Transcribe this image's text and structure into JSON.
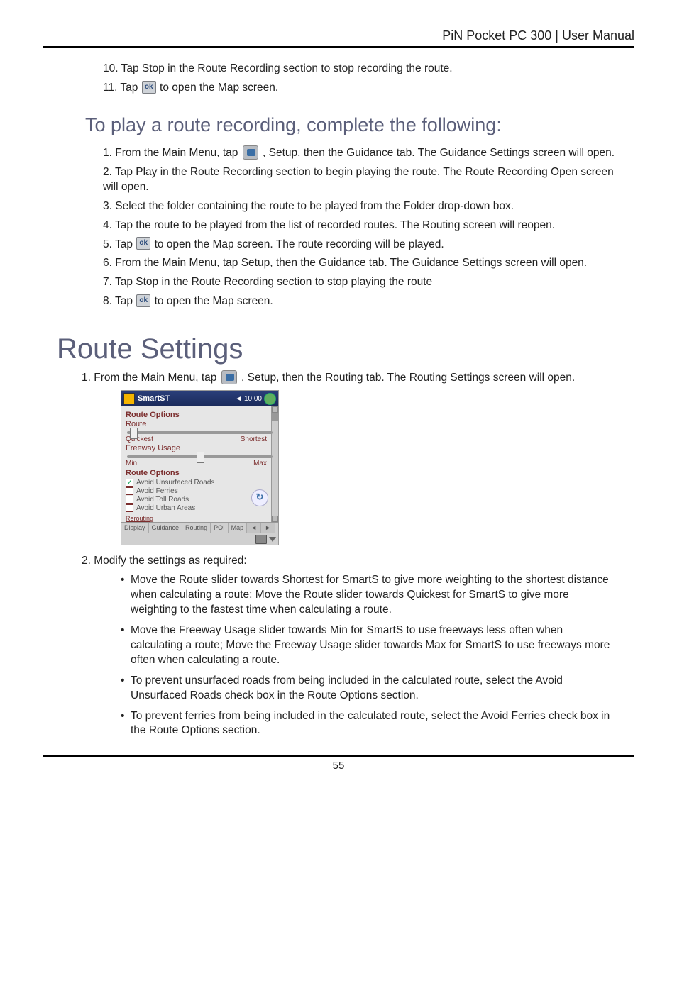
{
  "header": {
    "title": "PiN Pocket PC 300 | User Manual"
  },
  "topsteps": [
    "10. Tap Stop in the Route Recording section to stop recording the route.",
    "11. Tap |OK| to open the Map screen."
  ],
  "section_play": {
    "heading": "To play a route recording, complete the following:",
    "steps": [
      "1. From the Main Menu, tap |SETUP| , Setup, then the Guidance tab. The Guidance Settings screen will open.",
      "2. Tap Play in the Route Recording section to begin playing the route. The Route Recording Open screen will open.",
      "3. Select the folder containing the route to be played from the Folder drop-down box.",
      "4. Tap the route to be played from the list of recorded routes. The Routing screen will reopen.",
      "5. Tap |OK| to open the Map screen. The route recording will be played.",
      "6. From the Main Menu, tap Setup, then the Guidance tab. The Guidance Settings screen will open.",
      "7. Tap Stop in the Route Recording section to stop playing the route",
      "8. Tap |OK| to open the Map screen."
    ]
  },
  "section_route": {
    "heading": "Route Settings",
    "intro": "1. From the Main Menu, tap |SETUP| , Setup, then the Routing tab. The Routing Settings screen will open.",
    "device": {
      "title": "SmartST",
      "clock": "◄ 10:00",
      "h1": "Route Options",
      "sub1": "Route",
      "slider1": {
        "left": "Quickest",
        "right": "Shortest",
        "pos": 2
      },
      "sub2": "Freeway Usage",
      "slider2": {
        "left": "Min",
        "right": "Max",
        "pos": 48
      },
      "h2": "Route Options",
      "checks": [
        {
          "label": "Avoid Unsurfaced Roads",
          "checked": true
        },
        {
          "label": "Avoid Ferries",
          "checked": false
        },
        {
          "label": "Avoid Toll Roads",
          "checked": false
        },
        {
          "label": "Avoid Urban Areas",
          "checked": false
        }
      ],
      "tabs": [
        "Display",
        "Guidance",
        "Routing",
        "POI",
        "Map"
      ]
    },
    "step2": "2. Modify the settings as required:",
    "bullets": [
      "Move the Route slider towards Shortest for SmartS to give more weighting to the shortest distance when calculating a route; Move the Route slider towards Quickest for SmartS to give more weighting to the fastest time when calculating a route.",
      "Move the Freeway Usage slider towards Min for SmartS to use freeways less often when calculating a route; Move the Freeway Usage slider towards Max for SmartS to use freeways more often when calculating a route.",
      "To prevent unsurfaced roads from being included in the calculated route, select the Avoid Unsurfaced Roads check box in the Route Options section.",
      "To prevent ferries from being included in the calculated route, select the Avoid Ferries check box in the Route Options section."
    ]
  },
  "footer": {
    "page": "55"
  }
}
